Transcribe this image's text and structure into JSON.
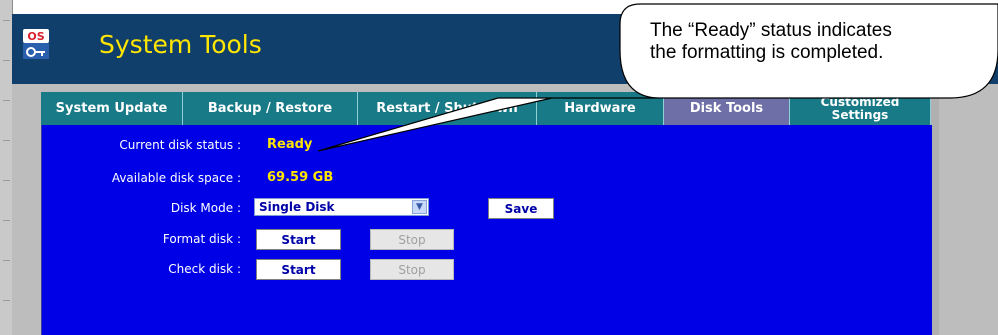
{
  "app": {
    "logo_text": "OS",
    "title": "System Tools"
  },
  "tabs": [
    {
      "label": "System Update",
      "active": false
    },
    {
      "label": "Backup / Restore",
      "active": false
    },
    {
      "label": "Restart / Shutdown",
      "active": false
    },
    {
      "label": "Hardware",
      "active": false
    },
    {
      "label": "Disk Tools",
      "active": true
    },
    {
      "label": "Customized Settings",
      "active": false
    }
  ],
  "disk": {
    "status_label": "Current disk status :",
    "status_value": "Ready",
    "space_label": "Available disk space :",
    "space_value": "69.59 GB",
    "mode_label": "Disk Mode :",
    "mode_value": "Single Disk",
    "save_label": "Save",
    "format_label": "Format disk :",
    "format_start": "Start",
    "format_stop": "Stop",
    "check_label": "Check disk :",
    "check_start": "Start",
    "check_stop": "Stop"
  },
  "callout": {
    "line1": "The “Ready” status indicates",
    "line2": "the formatting is completed."
  },
  "colors": {
    "header": "#113f6b",
    "title": "#ffe600",
    "tabs": "#177a86",
    "active_tab": "#6f6fa8",
    "content": "#0000e6"
  }
}
